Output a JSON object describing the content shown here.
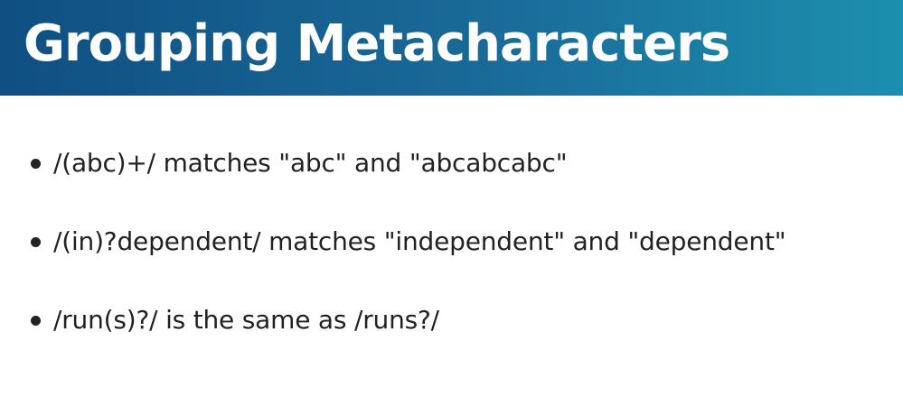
{
  "slide": {
    "title": "Grouping Metacharacters",
    "bullets": [
      "/(abc)+/ matches \"abc\" and \"abcabcabc\"",
      "/(in)?dependent/ matches \"independent\" and \"dependent\"",
      "/run(s)?/ is the same as /runs?/"
    ]
  },
  "colors": {
    "title_bar_start": "#0f4f82",
    "title_bar_end": "#1c8fae",
    "title_text": "#ffffff",
    "body_text": "#222222",
    "background": "#ffffff"
  }
}
